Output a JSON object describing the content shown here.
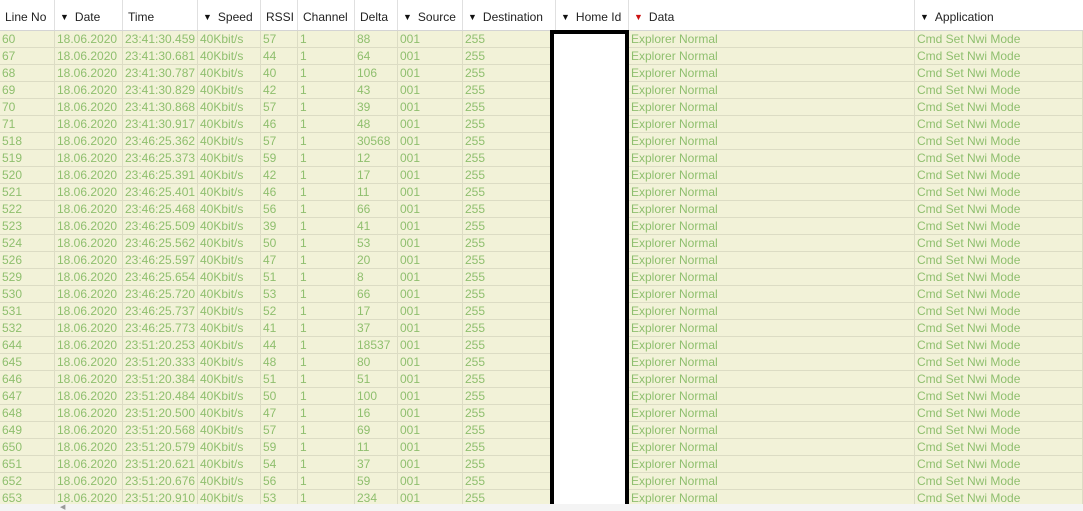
{
  "columns": [
    {
      "key": "line",
      "label": "Line No",
      "filter": false,
      "filter_active": false
    },
    {
      "key": "date",
      "label": "Date",
      "filter": true,
      "filter_active": false
    },
    {
      "key": "time",
      "label": "Time",
      "filter": false,
      "filter_active": false
    },
    {
      "key": "speed",
      "label": "Speed",
      "filter": true,
      "filter_active": false
    },
    {
      "key": "rssi",
      "label": "RSSI",
      "filter": false,
      "filter_active": false
    },
    {
      "key": "channel",
      "label": "Channel",
      "filter": false,
      "filter_active": false
    },
    {
      "key": "delta",
      "label": "Delta",
      "filter": false,
      "filter_active": false
    },
    {
      "key": "source",
      "label": "Source",
      "filter": true,
      "filter_active": false
    },
    {
      "key": "destination",
      "label": "Destination",
      "filter": true,
      "filter_active": false
    },
    {
      "key": "homeid",
      "label": "Home Id",
      "filter": true,
      "filter_active": false
    },
    {
      "key": "data",
      "label": "Data",
      "filter": true,
      "filter_active": true
    },
    {
      "key": "application",
      "label": "Application",
      "filter": true,
      "filter_active": false
    }
  ],
  "rows": [
    [
      "60",
      "18.06.2020",
      "23:41:30.459",
      "40Kbit/s",
      "57",
      "1",
      "88",
      "001",
      "255",
      "",
      "Explorer Normal",
      "Cmd Set Nwi Mode"
    ],
    [
      "67",
      "18.06.2020",
      "23:41:30.681",
      "40Kbit/s",
      "44",
      "1",
      "64",
      "001",
      "255",
      "",
      "Explorer Normal",
      "Cmd Set Nwi Mode"
    ],
    [
      "68",
      "18.06.2020",
      "23:41:30.787",
      "40Kbit/s",
      "40",
      "1",
      "106",
      "001",
      "255",
      "",
      "Explorer Normal",
      "Cmd Set Nwi Mode"
    ],
    [
      "69",
      "18.06.2020",
      "23:41:30.829",
      "40Kbit/s",
      "42",
      "1",
      "43",
      "001",
      "255",
      "",
      "Explorer Normal",
      "Cmd Set Nwi Mode"
    ],
    [
      "70",
      "18.06.2020",
      "23:41:30.868",
      "40Kbit/s",
      "57",
      "1",
      "39",
      "001",
      "255",
      "",
      "Explorer Normal",
      "Cmd Set Nwi Mode"
    ],
    [
      "71",
      "18.06.2020",
      "23:41:30.917",
      "40Kbit/s",
      "46",
      "1",
      "48",
      "001",
      "255",
      "",
      "Explorer Normal",
      "Cmd Set Nwi Mode"
    ],
    [
      "518",
      "18.06.2020",
      "23:46:25.362",
      "40Kbit/s",
      "57",
      "1",
      "30568",
      "001",
      "255",
      "",
      "Explorer Normal",
      "Cmd Set Nwi Mode"
    ],
    [
      "519",
      "18.06.2020",
      "23:46:25.373",
      "40Kbit/s",
      "59",
      "1",
      "12",
      "001",
      "255",
      "",
      "Explorer Normal",
      "Cmd Set Nwi Mode"
    ],
    [
      "520",
      "18.06.2020",
      "23:46:25.391",
      "40Kbit/s",
      "42",
      "1",
      "17",
      "001",
      "255",
      "",
      "Explorer Normal",
      "Cmd Set Nwi Mode"
    ],
    [
      "521",
      "18.06.2020",
      "23:46:25.401",
      "40Kbit/s",
      "46",
      "1",
      "11",
      "001",
      "255",
      "",
      "Explorer Normal",
      "Cmd Set Nwi Mode"
    ],
    [
      "522",
      "18.06.2020",
      "23:46:25.468",
      "40Kbit/s",
      "56",
      "1",
      "66",
      "001",
      "255",
      "",
      "Explorer Normal",
      "Cmd Set Nwi Mode"
    ],
    [
      "523",
      "18.06.2020",
      "23:46:25.509",
      "40Kbit/s",
      "39",
      "1",
      "41",
      "001",
      "255",
      "",
      "Explorer Normal",
      "Cmd Set Nwi Mode"
    ],
    [
      "524",
      "18.06.2020",
      "23:46:25.562",
      "40Kbit/s",
      "50",
      "1",
      "53",
      "001",
      "255",
      "",
      "Explorer Normal",
      "Cmd Set Nwi Mode"
    ],
    [
      "526",
      "18.06.2020",
      "23:46:25.597",
      "40Kbit/s",
      "47",
      "1",
      "20",
      "001",
      "255",
      "",
      "Explorer Normal",
      "Cmd Set Nwi Mode"
    ],
    [
      "529",
      "18.06.2020",
      "23:46:25.654",
      "40Kbit/s",
      "51",
      "1",
      "8",
      "001",
      "255",
      "",
      "Explorer Normal",
      "Cmd Set Nwi Mode"
    ],
    [
      "530",
      "18.06.2020",
      "23:46:25.720",
      "40Kbit/s",
      "53",
      "1",
      "66",
      "001",
      "255",
      "",
      "Explorer Normal",
      "Cmd Set Nwi Mode"
    ],
    [
      "531",
      "18.06.2020",
      "23:46:25.737",
      "40Kbit/s",
      "52",
      "1",
      "17",
      "001",
      "255",
      "",
      "Explorer Normal",
      "Cmd Set Nwi Mode"
    ],
    [
      "532",
      "18.06.2020",
      "23:46:25.773",
      "40Kbit/s",
      "41",
      "1",
      "37",
      "001",
      "255",
      "",
      "Explorer Normal",
      "Cmd Set Nwi Mode"
    ],
    [
      "644",
      "18.06.2020",
      "23:51:20.253",
      "40Kbit/s",
      "44",
      "1",
      "18537",
      "001",
      "255",
      "",
      "Explorer Normal",
      "Cmd Set Nwi Mode"
    ],
    [
      "645",
      "18.06.2020",
      "23:51:20.333",
      "40Kbit/s",
      "48",
      "1",
      "80",
      "001",
      "255",
      "",
      "Explorer Normal",
      "Cmd Set Nwi Mode"
    ],
    [
      "646",
      "18.06.2020",
      "23:51:20.384",
      "40Kbit/s",
      "51",
      "1",
      "51",
      "001",
      "255",
      "",
      "Explorer Normal",
      "Cmd Set Nwi Mode"
    ],
    [
      "647",
      "18.06.2020",
      "23:51:20.484",
      "40Kbit/s",
      "50",
      "1",
      "100",
      "001",
      "255",
      "",
      "Explorer Normal",
      "Cmd Set Nwi Mode"
    ],
    [
      "648",
      "18.06.2020",
      "23:51:20.500",
      "40Kbit/s",
      "47",
      "1",
      "16",
      "001",
      "255",
      "",
      "Explorer Normal",
      "Cmd Set Nwi Mode"
    ],
    [
      "649",
      "18.06.2020",
      "23:51:20.568",
      "40Kbit/s",
      "57",
      "1",
      "69",
      "001",
      "255",
      "",
      "Explorer Normal",
      "Cmd Set Nwi Mode"
    ],
    [
      "650",
      "18.06.2020",
      "23:51:20.579",
      "40Kbit/s",
      "59",
      "1",
      "11",
      "001",
      "255",
      "",
      "Explorer Normal",
      "Cmd Set Nwi Mode"
    ],
    [
      "651",
      "18.06.2020",
      "23:51:20.621",
      "40Kbit/s",
      "54",
      "1",
      "37",
      "001",
      "255",
      "",
      "Explorer Normal",
      "Cmd Set Nwi Mode"
    ],
    [
      "652",
      "18.06.2020",
      "23:51:20.676",
      "40Kbit/s",
      "56",
      "1",
      "59",
      "001",
      "255",
      "",
      "Explorer Normal",
      "Cmd Set Nwi Mode"
    ],
    [
      "653",
      "18.06.2020",
      "23:51:20.910",
      "40Kbit/s",
      "53",
      "1",
      "234",
      "001",
      "255",
      "",
      "Explorer Normal",
      "Cmd Set Nwi Mode"
    ]
  ],
  "colors": {
    "row_bg": "#f2f2d8",
    "row_text": "#8fbf6e",
    "filter_active": "#cc1111"
  },
  "icons": {
    "filter": "filter-icon"
  }
}
